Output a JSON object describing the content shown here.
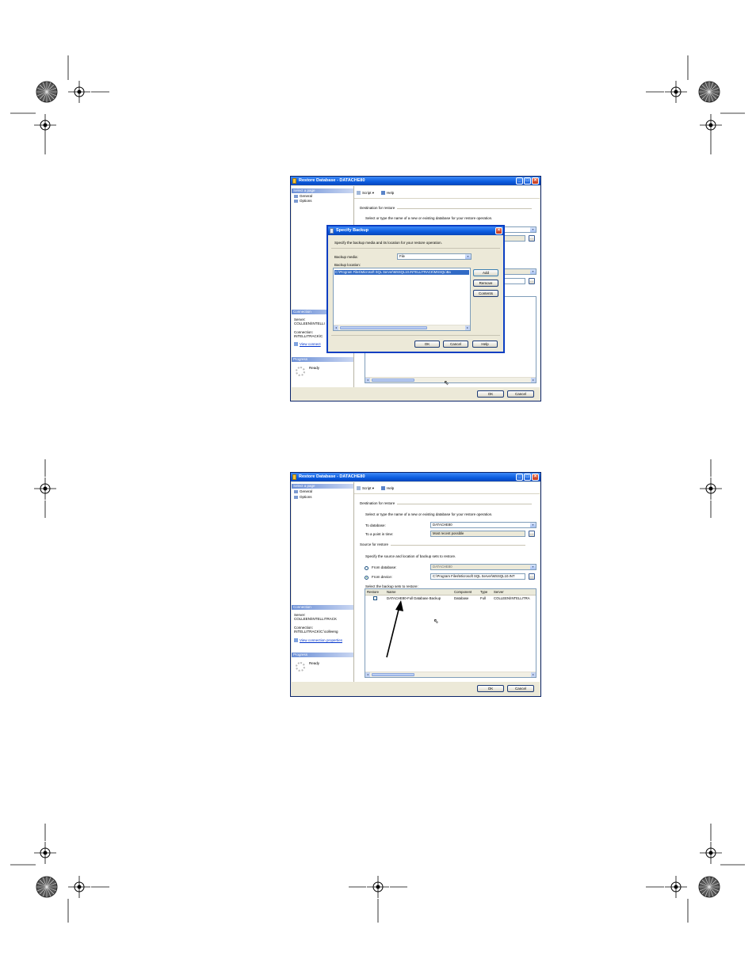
{
  "screen1": {
    "title": "Restore Database - DATACHE80",
    "left": {
      "select_page": "Select a page",
      "items": [
        "General",
        "Options"
      ],
      "connection_header": "Connection",
      "server_label": "Server:",
      "server_value": "COLLEEN\\INTELLI",
      "connection_label": "Connection:",
      "connection_value": "INTELLITRACK\\C",
      "view_link": "View connect",
      "progress_header": "Progress",
      "progress_status": "Ready"
    },
    "toolbar": {
      "script": "Script",
      "help": "Help"
    },
    "destination_header": "Destination for restore",
    "destination_hint": "Select or type the name of a new or existing database for your restore operation.",
    "ok": "OK",
    "cancel": "Cancel"
  },
  "dialog": {
    "title": "Specify Backup",
    "hint": "Specify the backup media and its location for your restore operation.",
    "media_label": "Backup media:",
    "media_value": "File",
    "location_label": "Backup location:",
    "location_value": "C:\\Program Files\\Microsoft SQL Server\\MSSQL10.INTELLITRACK\\MSSQL\\Ba",
    "add": "Add",
    "remove": "Remove",
    "contents": "Contents",
    "ok": "OK",
    "cancel": "Cancel",
    "help": "Help"
  },
  "screen2": {
    "title": "Restore Database - DATACHE80",
    "left": {
      "select_page": "Select a page",
      "items": [
        "General",
        "Options"
      ],
      "connection_header": "Connection",
      "server_label": "Server:",
      "server_value": "COLLEEN\\INTELLITRACK",
      "connection_label": "Connection:",
      "connection_value": "INTELLITRACK\\C:\\colleeng",
      "view_link": "View connection properties",
      "progress_header": "Progress",
      "progress_status": "Ready"
    },
    "toolbar": {
      "script": "Script",
      "help": "Help"
    },
    "destination_header": "Destination for restore",
    "destination_hint": "Select or type the name of a new or existing database for your restore operation.",
    "to_database_label": "To database:",
    "to_database_value": "DATACHE80",
    "point_in_time_label": "To a point in time:",
    "point_in_time_value": "Most recent possible",
    "source_header": "Source for restore",
    "source_hint": "Specify the source and location of backup sets to restore.",
    "from_database_label": "From database:",
    "from_database_value": "DATACHE80",
    "from_device_label": "From device:",
    "from_device_value": "C:\\Program Files\\Microsoft SQL Server\\MSSQL10.INT",
    "backup_sets_label": "Select the backup sets to restore:",
    "columns": [
      "Restore",
      "Name",
      "Component",
      "Type",
      "Server"
    ],
    "row": {
      "name": "DATACHE80-Full Database Backup",
      "component": "Database",
      "type": "Full",
      "server": "COLLEEN\\INTELLITRA"
    },
    "ok": "OK",
    "cancel": "Cancel"
  }
}
